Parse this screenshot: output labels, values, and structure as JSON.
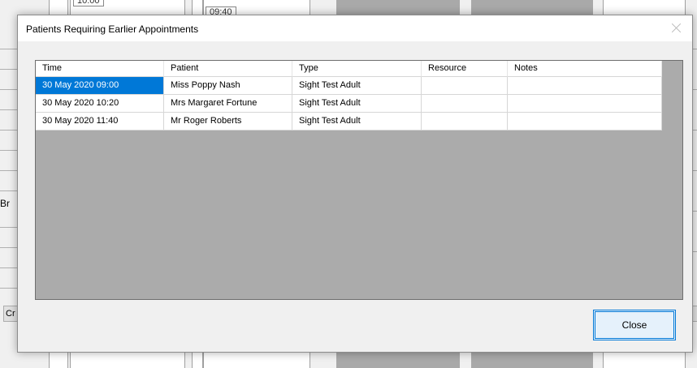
{
  "background": {
    "times": [
      "10:00",
      "09:40"
    ],
    "left_text": "Br",
    "left_button": "Cr"
  },
  "dialog": {
    "title": "Patients Requiring Earlier Appointments",
    "close_button": "Close",
    "columns": [
      "Time",
      "Patient",
      "Type",
      "Resource",
      "Notes"
    ],
    "rows": [
      {
        "time": "30 May 2020 09:00",
        "patient": "Miss Poppy Nash",
        "type": "Sight Test Adult",
        "resource": "",
        "notes": "",
        "selected": true
      },
      {
        "time": "30 May 2020 10:20",
        "patient": "Mrs Margaret Fortune",
        "type": "Sight Test Adult",
        "resource": "",
        "notes": "",
        "selected": false
      },
      {
        "time": "30 May 2020 11:40",
        "patient": "Mr Roger Roberts",
        "type": "Sight Test Adult",
        "resource": "",
        "notes": "",
        "selected": false
      }
    ]
  },
  "colors": {
    "selection": "#0078d7",
    "grid_background": "#ababab"
  }
}
